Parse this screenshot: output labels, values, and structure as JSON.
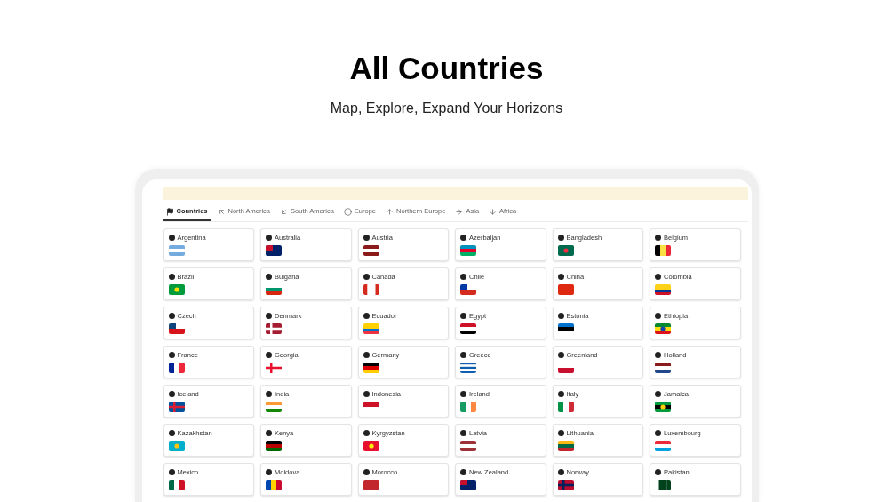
{
  "header": {
    "title": "All Countries",
    "subtitle": "Map, Explore, Expand Your Horizons"
  },
  "tabs": [
    {
      "label": "Countries",
      "selected": true
    },
    {
      "label": "North America",
      "selected": false
    },
    {
      "label": "South America",
      "selected": false
    },
    {
      "label": "Europe",
      "selected": false
    },
    {
      "label": "Northern Europe",
      "selected": false
    },
    {
      "label": "Asia",
      "selected": false
    },
    {
      "label": "Africa",
      "selected": false
    }
  ],
  "countries": [
    "Argentina",
    "Australia",
    "Austria",
    "Azerbaijan",
    "Bangladesh",
    "Belgium",
    "Brazil",
    "Bulgaria",
    "Canada",
    "Chile",
    "China",
    "Colombia",
    "Czech",
    "Denmark",
    "Ecuador",
    "Egypt",
    "Estonia",
    "Ethiopia",
    "France",
    "Georgia",
    "Germany",
    "Greece",
    "Greenland",
    "Holland",
    "Iceland",
    "India",
    "Indonesia",
    "Ireland",
    "Italy",
    "Jamaica",
    "Kazakhstan",
    "Kenya",
    "Kyrgyzstan",
    "Latvia",
    "Lithuania",
    "Luxembourg",
    "Mexico",
    "Moldova",
    "Morocco",
    "New Zealand",
    "Norway",
    "Pakistan"
  ]
}
